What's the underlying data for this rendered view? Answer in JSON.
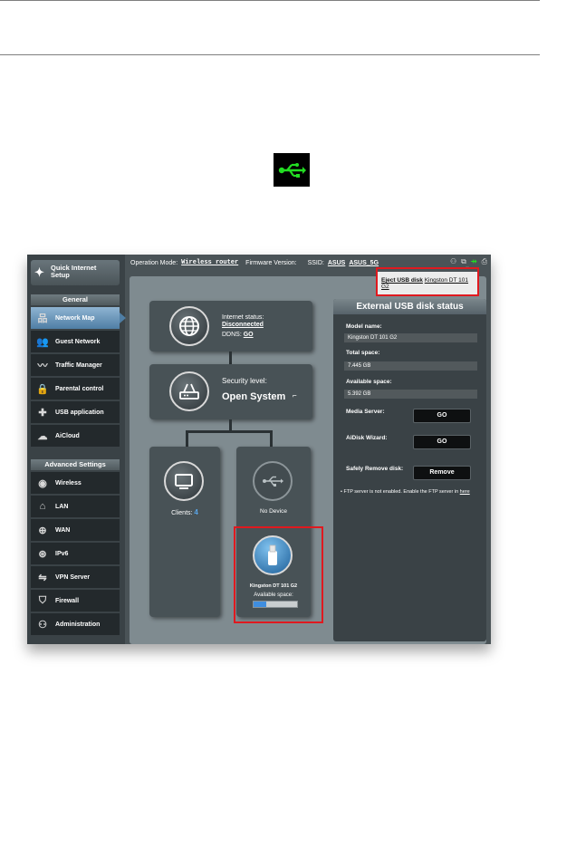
{
  "router": {
    "topbar": {
      "op_mode_label": "Operation Mode:",
      "op_mode_value": "Wireless router",
      "fw_label": "Firmware Version:",
      "ssid_label": "SSID:",
      "ssid_1": "ASUS",
      "ssid_2": "ASUS_5G"
    },
    "sidebar": {
      "qis_label_1": "Quick Internet",
      "qis_label_2": "Setup",
      "general_label": "General",
      "general_items": [
        {
          "label": "Network Map",
          "icon": "network-map-icon"
        },
        {
          "label": "Guest Network",
          "icon": "guest-network-icon"
        },
        {
          "label": "Traffic Manager",
          "icon": "traffic-manager-icon"
        },
        {
          "label": "Parental control",
          "icon": "lock-icon"
        },
        {
          "label": "USB application",
          "icon": "puzzle-icon"
        },
        {
          "label": "AiCloud",
          "icon": "cloud-icon"
        }
      ],
      "advanced_label": "Advanced Settings",
      "advanced_items": [
        {
          "label": "Wireless",
          "icon": "wifi-icon"
        },
        {
          "label": "LAN",
          "icon": "home-icon"
        },
        {
          "label": "WAN",
          "icon": "globe-icon"
        },
        {
          "label": "IPv6",
          "icon": "ipv6-globe-icon"
        },
        {
          "label": "VPN Server",
          "icon": "vpn-icon"
        },
        {
          "label": "Firewall",
          "icon": "shield-icon"
        },
        {
          "label": "Administration",
          "icon": "admin-icon"
        }
      ]
    },
    "map": {
      "internet_status_label": "Internet status:",
      "internet_status_value": "Disconnected",
      "ddns_label": "DDNS:",
      "ddns_link": "GO",
      "security_label": "Security level:",
      "security_value": "Open System",
      "clients_label": "Clients:",
      "clients_count": "4",
      "no_device_label": "No Device",
      "usb_device_name": "Kingston DT 101 G2",
      "available_space_label": "Available space:",
      "available_space_fraction": 0.3
    },
    "tooltip": {
      "eject_label": "Eject USB disk",
      "device_name": "Kingston DT 101 G2"
    },
    "panel": {
      "title": "External USB disk status",
      "model_name_label": "Model name:",
      "model_name_value": "Kingston DT 101 G2",
      "total_space_label": "Total space:",
      "total_space_value": "7.445 GB",
      "available_space_label": "Available space:",
      "available_space_value": "5.392 GB",
      "media_server_label": "Media Server:",
      "media_server_button": "GO",
      "aidisk_label": "AiDisk Wizard:",
      "aidisk_button": "GO",
      "remove_label": "Safely Remove disk:",
      "remove_button": "Remove",
      "ftp_note": "FTP server is not enabled. Enable the FTP server in",
      "ftp_link": "here"
    },
    "colors": {
      "usb_icon_green": "#22dd22",
      "highlight_red": "#e0191f",
      "active_nav_blue": "#4f7ea5"
    }
  }
}
